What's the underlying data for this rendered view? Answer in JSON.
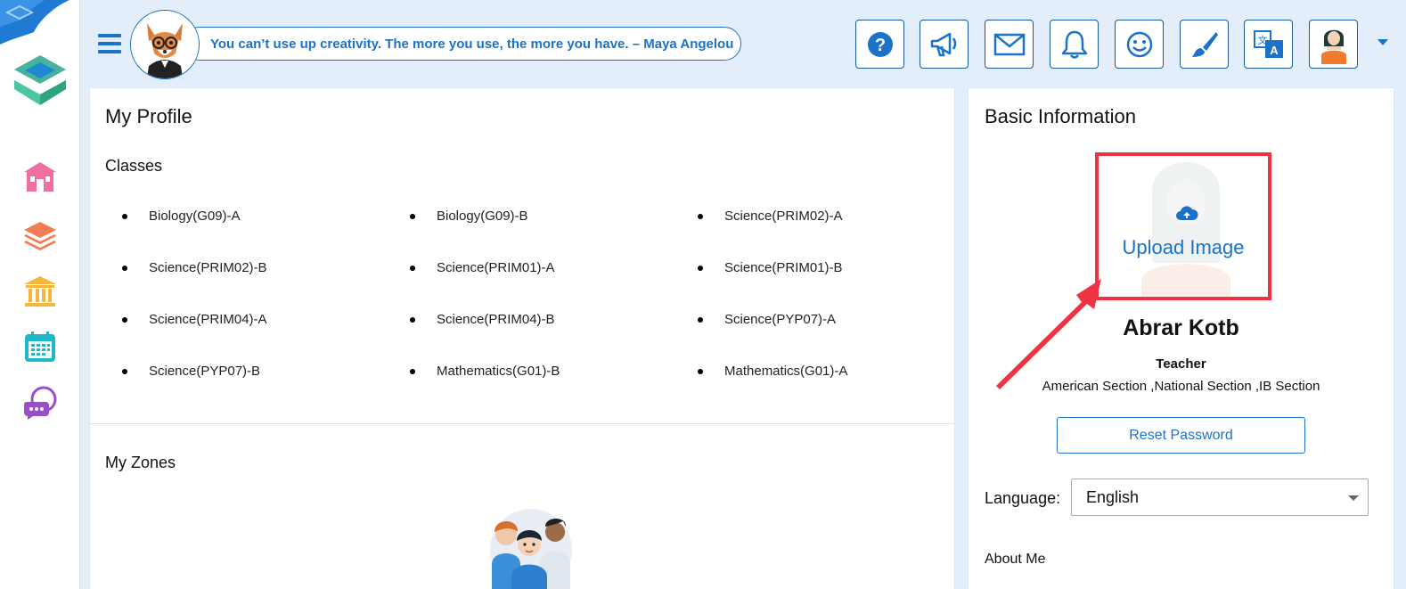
{
  "header": {
    "quote": "You can’t use up creativity. The more you use, the more you have. – Maya Angelou",
    "icons": [
      "help-icon",
      "megaphone-icon",
      "mail-icon",
      "bell-icon",
      "smiley-icon",
      "paintbrush-icon",
      "translate-icon",
      "user-avatar-icon"
    ]
  },
  "sidebar": {
    "items": [
      "school-icon",
      "layers-icon",
      "institution-icon",
      "calendar-icon",
      "chat-icon"
    ]
  },
  "profile": {
    "title": "My Profile",
    "classes_heading": "Classes",
    "classes": [
      "Biology(G09)-A",
      "Biology(G09)-B",
      "Science(PRIM02)-A",
      "Science(PRIM02)-B",
      "Science(PRIM01)-A",
      "Science(PRIM01)-B",
      "Science(PRIM04)-A",
      "Science(PRIM04)-B",
      "Science(PYP07)-A",
      "Science(PYP07)-B",
      "Mathematics(G01)-B",
      "Mathematics(G01)-A"
    ],
    "zones_heading": "My Zones"
  },
  "basic_info": {
    "title": "Basic Information",
    "upload_label": "Upload Image",
    "name": "Abrar Kotb",
    "role": "Teacher",
    "sections": "American Section ,National Section ,IB Section",
    "reset_password": "Reset Password",
    "language_label": "Language:",
    "language_value": "English",
    "about_label": "About Me"
  },
  "colors": {
    "accent": "#1a73c9",
    "highlight": "#ee3344",
    "background": "#e4eefa"
  }
}
